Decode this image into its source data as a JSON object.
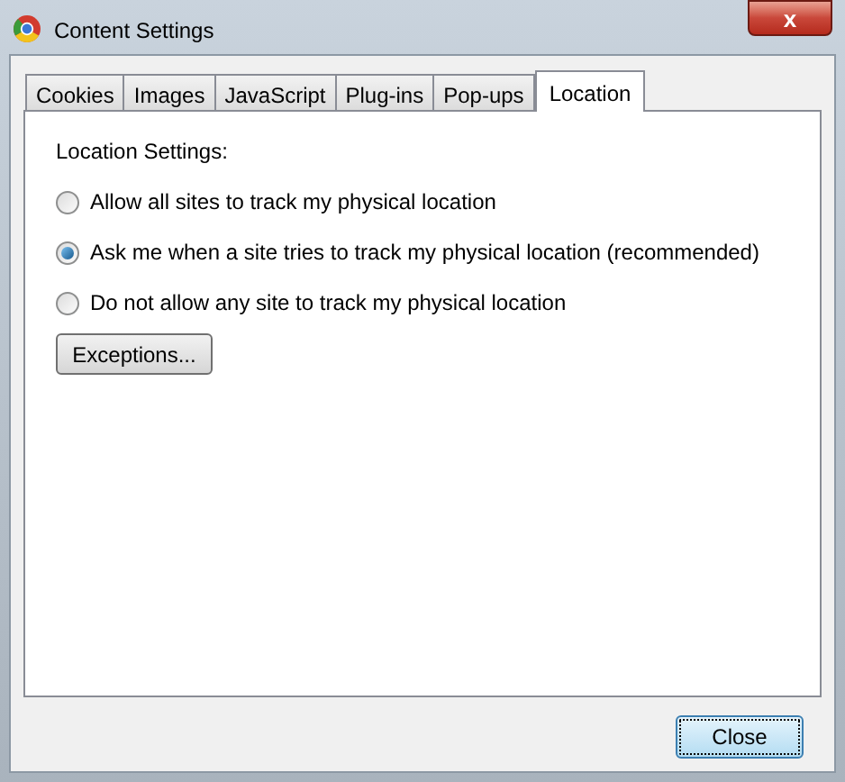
{
  "window": {
    "title": "Content Settings",
    "close_glyph": "x"
  },
  "tabs": [
    {
      "label": "Cookies",
      "selected": false
    },
    {
      "label": "Images",
      "selected": false
    },
    {
      "label": "JavaScript",
      "selected": false
    },
    {
      "label": "Plug-ins",
      "selected": false
    },
    {
      "label": "Pop-ups",
      "selected": false
    },
    {
      "label": "Location",
      "selected": true
    }
  ],
  "section_title": "Location Settings:",
  "options": [
    {
      "label": "Allow all sites to track my physical location",
      "selected": false
    },
    {
      "label": "Ask me when a site tries to track my physical location (recommended)",
      "selected": true
    },
    {
      "label": "Do not allow any site to track my physical location",
      "selected": false
    }
  ],
  "exceptions_button": "Exceptions...",
  "close_button": "Close"
}
